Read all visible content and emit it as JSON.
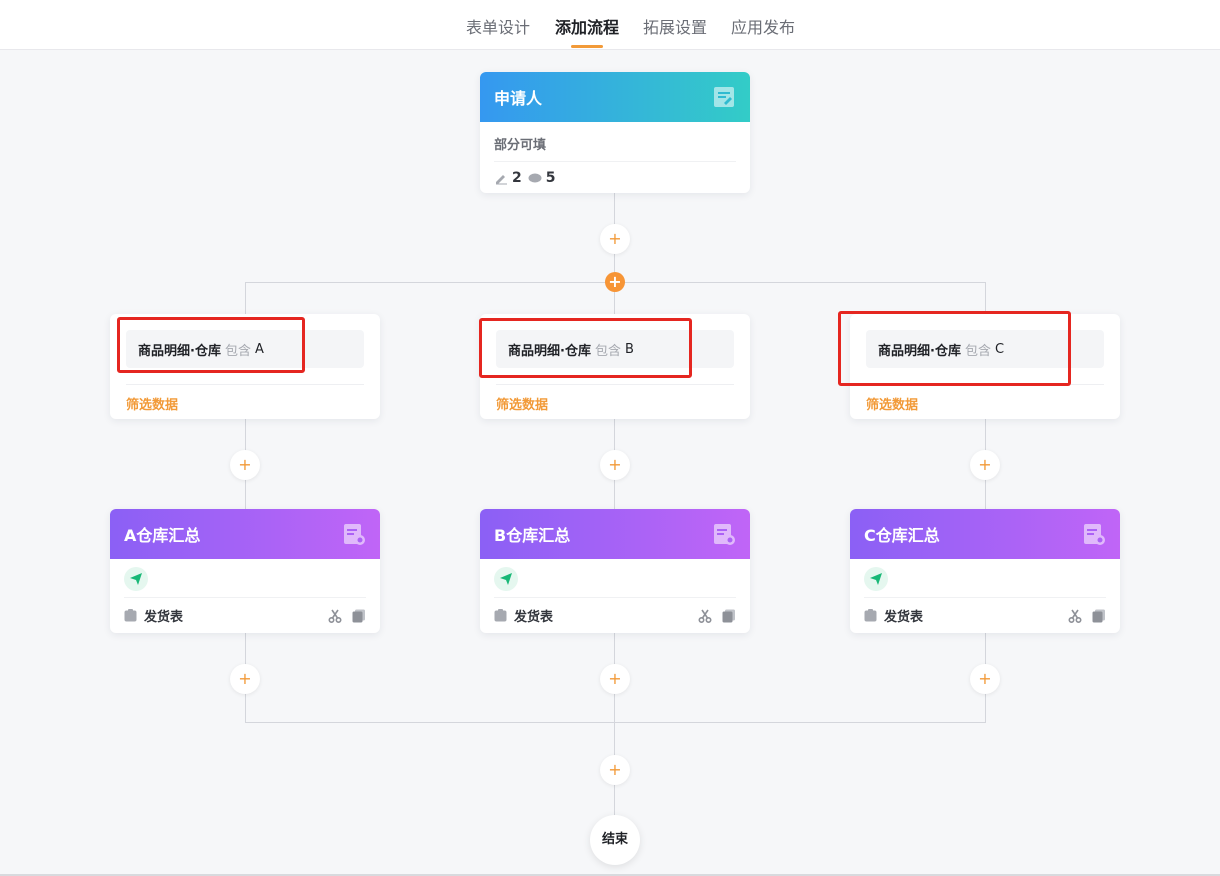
{
  "tabs": [
    {
      "label": "表单设计"
    },
    {
      "label": "添加流程"
    },
    {
      "label": "拓展设置"
    },
    {
      "label": "应用发布"
    }
  ],
  "applicant": {
    "title": "申请人",
    "subtitle": "部分可填",
    "edit_count": "2",
    "view_count": "5"
  },
  "add_symbol": "+",
  "branches": [
    {
      "condition": {
        "field": "商品明细·仓库",
        "operator": "包含",
        "value": "A",
        "link": "筛选数据"
      },
      "summary": {
        "title": "A仓库汇总",
        "table": "发货表"
      }
    },
    {
      "condition": {
        "field": "商品明细·仓库",
        "operator": "包含",
        "value": "B",
        "link": "筛选数据"
      },
      "summary": {
        "title": "B仓库汇总",
        "table": "发货表"
      }
    },
    {
      "condition": {
        "field": "商品明细·仓库",
        "operator": "包含",
        "value": "C",
        "link": "筛选数据"
      },
      "summary": {
        "title": "C仓库汇总",
        "table": "发货表"
      }
    }
  ],
  "end_label": "结束",
  "colors": {
    "accent": "#f29a38",
    "applicant_gradient": [
      "#3598f0",
      "#33ccc7"
    ],
    "summary_gradient": [
      "#8b60f5",
      "#c065f7"
    ],
    "highlight": "#e52620",
    "send_icon": "#19b877"
  },
  "icons": {
    "applicant": "form-edit-icon",
    "summary": "report-icon",
    "send": "paper-plane-icon",
    "table": "clipboard-icon",
    "cut": "scissors-icon",
    "copy": "copy-icon",
    "edit": "pencil-icon",
    "view": "eye-icon"
  }
}
